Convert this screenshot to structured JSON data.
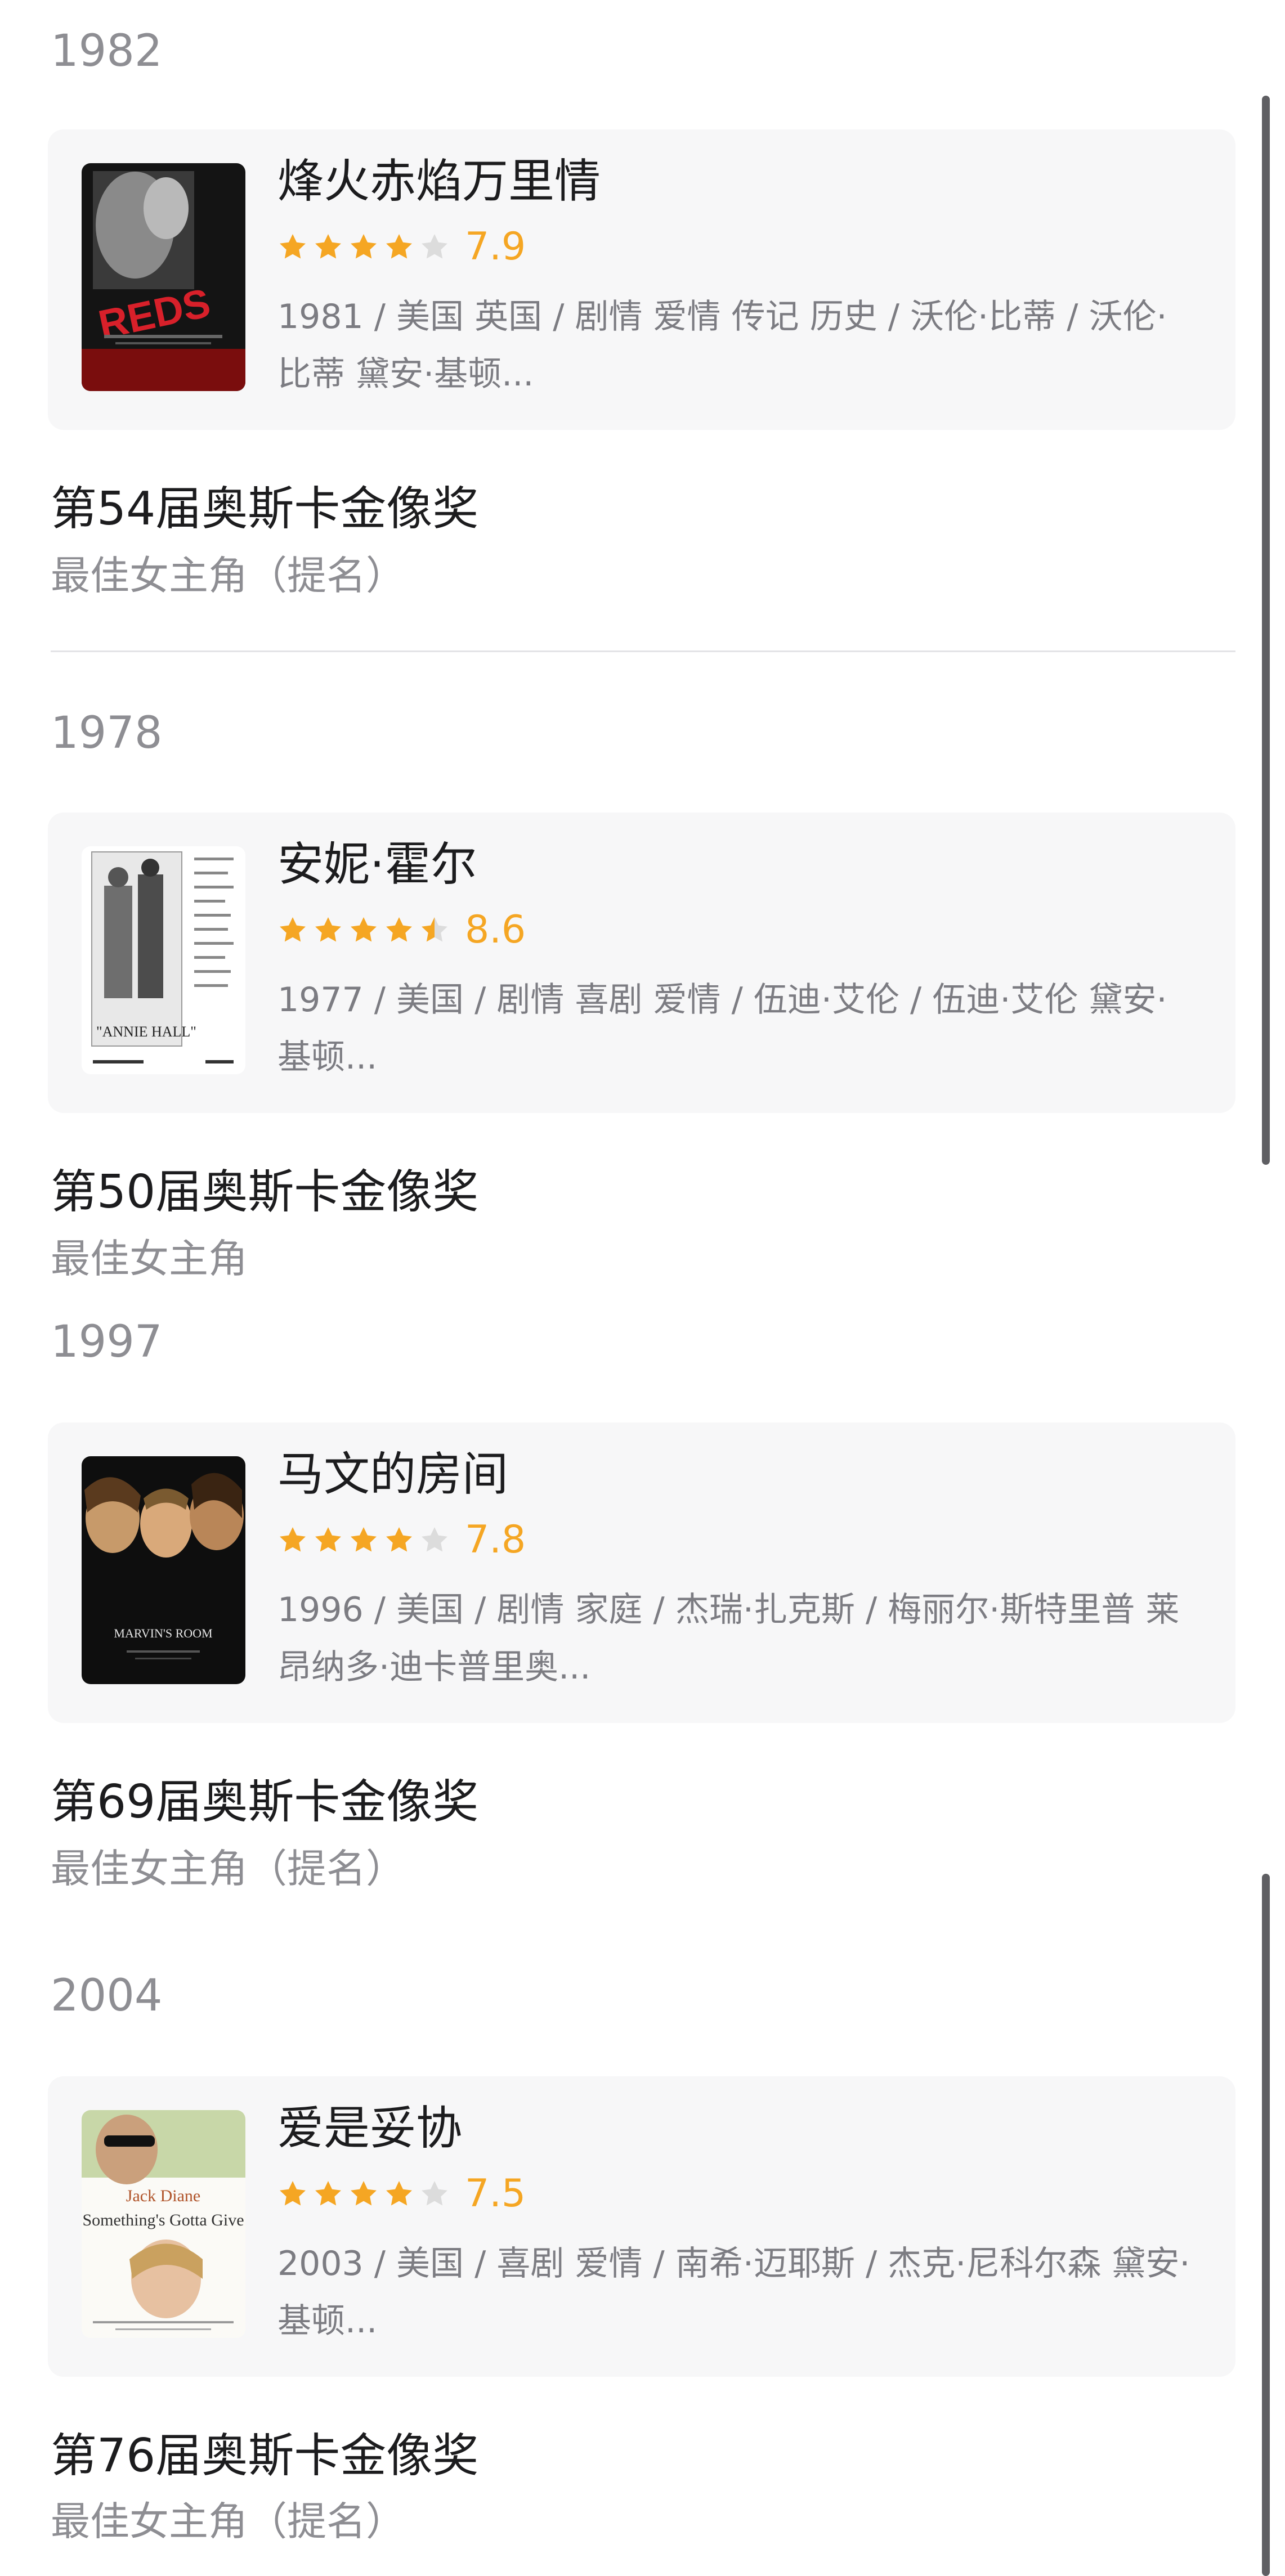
{
  "entries": [
    {
      "year": "1982",
      "film": {
        "title": "烽火赤焰万里情",
        "stars": 4,
        "score": "7.9",
        "meta": "1981 / 美国 英国 / 剧情 爱情 传记 历史 / 沃伦·比蒂 / 沃伦·比蒂 黛安·基顿..."
      },
      "award": "第54届奥斯卡金像奖",
      "category": "最佳女主角（提名）"
    },
    {
      "year": "1978",
      "film": {
        "title": "安妮·霍尔",
        "stars": 4.5,
        "score": "8.6",
        "meta": "1977 / 美国 / 剧情 喜剧 爱情 / 伍迪·艾伦 / 伍迪·艾伦 黛安·基顿..."
      },
      "award": "第50届奥斯卡金像奖",
      "category": "最佳女主角"
    },
    {
      "year": "1997",
      "film": {
        "title": "马文的房间",
        "stars": 4,
        "score": "7.8",
        "meta": "1996 / 美国 / 剧情 家庭 / 杰瑞·扎克斯 / 梅丽尔·斯特里普 莱昂纳多·迪卡普里奥..."
      },
      "award": "第69届奥斯卡金像奖",
      "category": "最佳女主角（提名）"
    },
    {
      "year": "2004",
      "film": {
        "title": "爱是妥协",
        "stars": 4,
        "score": "7.5",
        "meta": "2003 / 美国 / 喜剧 爱情 / 南希·迈耶斯 / 杰克·尼科尔森 黛安·基顿..."
      },
      "award": "第76届奥斯卡金像奖",
      "category": "最佳女主角（提名）"
    }
  ],
  "posters": {
    "reds_text": "REDS",
    "annie_hall_text": "\"ANNIE HALL\"",
    "marvins_room_text": "MARVIN'S ROOM",
    "somethings_top": "Jack Diane",
    "somethings_title": "Something's Gotta Give"
  },
  "colors": {
    "star_filled": "#f5a623",
    "star_empty": "#dcdcdc",
    "score": "#f5a623"
  }
}
